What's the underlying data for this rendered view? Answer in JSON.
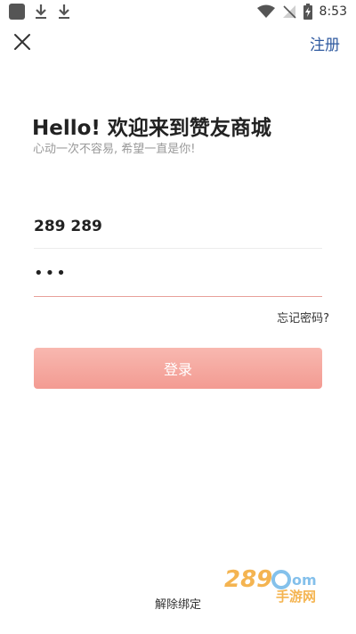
{
  "status_bar": {
    "time": "8:53",
    "icons": [
      "app-icon",
      "download-icon",
      "download-icon",
      "wifi-icon",
      "no-signal-icon",
      "battery-charging-icon"
    ]
  },
  "top_bar": {
    "close_icon": "close-icon",
    "register_label": "注册"
  },
  "header": {
    "title": "Hello! 欢迎来到赞友商城",
    "subtitle": "心动一次不容易, 希望一直是你!"
  },
  "form": {
    "username_value": "289 289",
    "password_value": "•••",
    "forgot_label": "忘记密码?",
    "login_label": "登录"
  },
  "footer": {
    "unbind_label": "解除绑定"
  },
  "watermark": {
    "text": "289.com 手游网"
  },
  "colors": {
    "accent": "#2f5aa0",
    "login_button": "#f39b92",
    "password_underline": "#e8a09a"
  }
}
